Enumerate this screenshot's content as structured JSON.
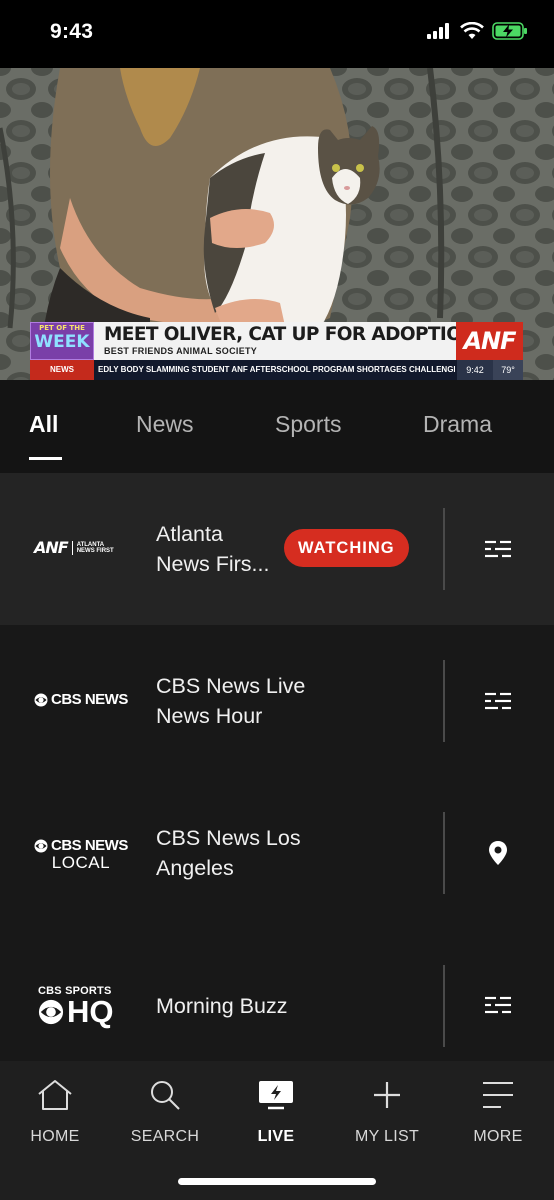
{
  "status_bar": {
    "time": "9:43"
  },
  "video": {
    "lower_third": {
      "pet_line1": "PET OF THE",
      "pet_line2": "WEEK",
      "headline": "MEET OLIVER, CAT UP FOR ADOPTION",
      "sub_headline": "BEST FRIENDS ANIMAL SOCIETY",
      "station_logo": "ANF",
      "ticker_label": "NEWS",
      "ticker_text": "EDLY BODY SLAMMING STUDENT  ANF  AFTERSCHOOL PROGRAM SHORTAGES CHALLENGE ST",
      "ticker_time": "9:42",
      "ticker_temp": "79°"
    }
  },
  "tabs": [
    {
      "label": "All",
      "active": true
    },
    {
      "label": "News",
      "active": false
    },
    {
      "label": "Sports",
      "active": false
    },
    {
      "label": "Drama",
      "active": false
    }
  ],
  "channels": [
    {
      "logo_text": "ANF",
      "logo_sub1": "ATLANTA",
      "logo_sub2": "NEWS FIRST",
      "title_line1": "Atlanta",
      "title_line2": "News Firs...",
      "badge": "WATCHING",
      "action_icon": "schedule-list-icon"
    },
    {
      "logo_text": "CBS NEWS",
      "title_line1": "CBS News Live",
      "title_line2": "News Hour",
      "action_icon": "schedule-list-icon"
    },
    {
      "logo_text": "CBS NEWS",
      "logo_sub": "LOCAL",
      "title_line1": "CBS News Los",
      "title_line2": "Angeles",
      "action_icon": "location-pin-icon"
    },
    {
      "logo_text_top": "CBS SPORTS",
      "logo_text_bottom": "HQ",
      "title_line1": "Morning Buzz",
      "action_icon": "schedule-list-icon"
    }
  ],
  "bottom_nav": {
    "home": "HOME",
    "search": "SEARCH",
    "live": "LIVE",
    "my_list": "MY LIST",
    "more": "MORE",
    "active": "live"
  },
  "colors": {
    "accent_red": "#d62d20",
    "background": "#141414",
    "row_selected": "#242424",
    "battery_green": "#4cd964"
  }
}
